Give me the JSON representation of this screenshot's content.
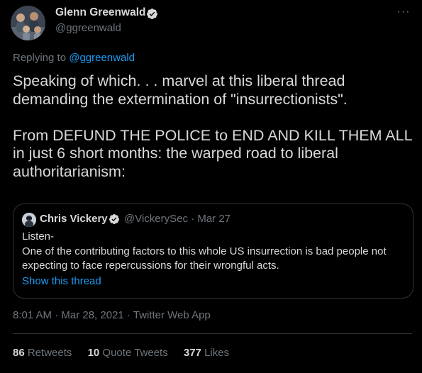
{
  "author": {
    "display_name": "Glenn Greenwald",
    "handle": "@ggreenwald",
    "verified_icon": "verified-badge-icon",
    "avatar_icon": "profile-photo-avatar"
  },
  "more_icon": "more-options-icon",
  "reply_context": {
    "prefix": "Replying to",
    "mention": "@ggreenwald"
  },
  "tweet": {
    "text": "Speaking of which. . . marvel at this liberal thread demanding the extermination of \"insurrectionists\".\n\nFrom DEFUND THE POLICE to END AND KILL THEM ALL in just 6 short months: the warped road to liberal authoritarianism:"
  },
  "quoted_tweet": {
    "display_name": "Chris Vickery",
    "handle": "@VickerySec",
    "separator": "·",
    "date": "Mar 27",
    "text": "Listen-\nOne of the contributing factors to this whole US insurrection is bad people not expecting to face repercussions for their wrongful acts.",
    "show_thread": "Show this thread"
  },
  "meta": {
    "timestamp": "8:01 AM · Mar 28, 2021 · Twitter Web App"
  },
  "stats": [
    {
      "count": "86",
      "label": "Retweets"
    },
    {
      "count": "10",
      "label": "Quote Tweets"
    },
    {
      "count": "377",
      "label": "Likes"
    }
  ],
  "colors": {
    "background": "#000000",
    "text": "#d9d9d9",
    "secondary": "#6e767d",
    "link": "#1d9bf0",
    "border": "#2f3336"
  }
}
